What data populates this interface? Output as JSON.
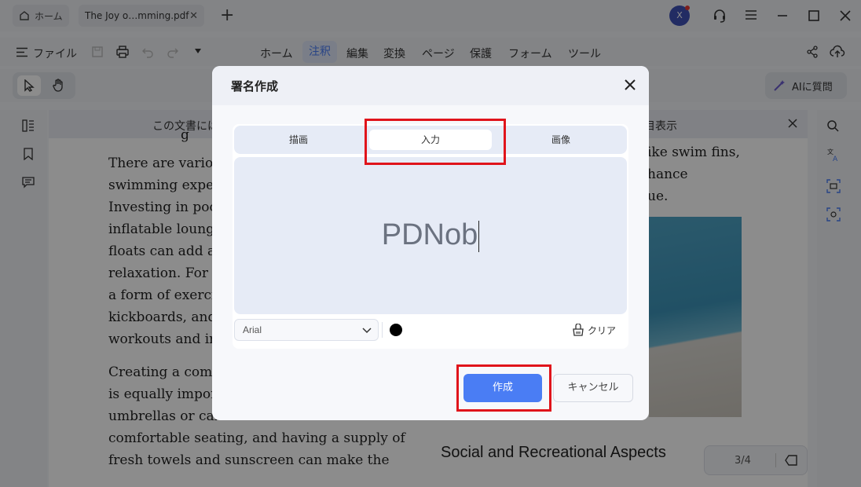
{
  "titlebar": {
    "home_tab": "ホーム",
    "doc_tab": "The Joy o…mming.pdf",
    "close_glyph": "✕",
    "add_glyph": "+",
    "avatar_letter": "X"
  },
  "menubar": {
    "file": "ファイル",
    "items": [
      "ホーム",
      "注釈",
      "編集",
      "変換",
      "ページ",
      "保護",
      "フォーム",
      "ツール"
    ],
    "active": "注釈"
  },
  "toolbar": {
    "ai_label": "AIに質問"
  },
  "banner": {
    "left_text": "この文書には",
    "right_text": "目表示"
  },
  "document": {
    "left_col_1": "There are vario\nswimming expe\nInvesting in poo\ninflatable loung\nfloats can add a\nrelaxation. For t\na form of exerci\nkickboards, and\nworkouts and in",
    "left_col_2": "Creating a comf\nis equally impor\numbrellas or cab\ncomfortable seating, and having a supply of\nfresh towels and sunscreen can make the",
    "right_col": "ike swim fins,\nhance\nue.",
    "right_heading": "Social and Recreational Aspects",
    "top_fragment": "g"
  },
  "pager": {
    "label": "3/4"
  },
  "dialog": {
    "title": "署名作成",
    "tabs": [
      "描画",
      "入力",
      "画像"
    ],
    "active_tab": "入力",
    "signature_text": "PDNob",
    "font": "Arial",
    "color": "#000000",
    "clear_label": "クリア",
    "create_label": "作成",
    "cancel_label": "キャンセル"
  },
  "colors": {
    "accent": "#4a7df4",
    "highlight_box": "#e0141b",
    "avatar": "#3f51b5"
  }
}
